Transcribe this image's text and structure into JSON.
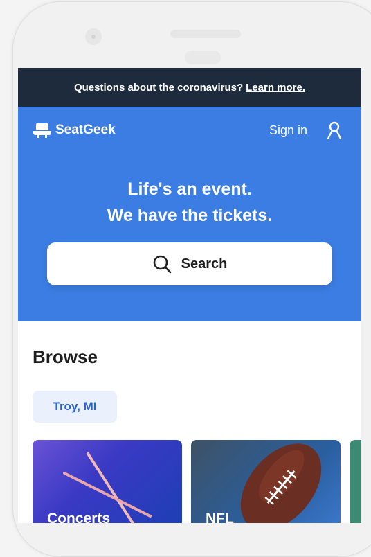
{
  "banner": {
    "text": "Questions about the coronavirus?",
    "link": "Learn more."
  },
  "nav": {
    "logo_text": "SeatGeek",
    "sign_in": "Sign in"
  },
  "hero": {
    "headline_line1": "Life's an event.",
    "headline_line2": "We have the tickets.",
    "search_label": "Search"
  },
  "browse": {
    "title": "Browse",
    "location_chip": "Troy, MI",
    "categories": [
      {
        "label": "Concerts"
      },
      {
        "label": "NFL"
      }
    ]
  },
  "colors": {
    "banner_bg": "#1d2b3d",
    "brand_blue": "#3b7de3",
    "chip_bg": "#eaf1fc",
    "chip_text": "#2a63c4"
  }
}
